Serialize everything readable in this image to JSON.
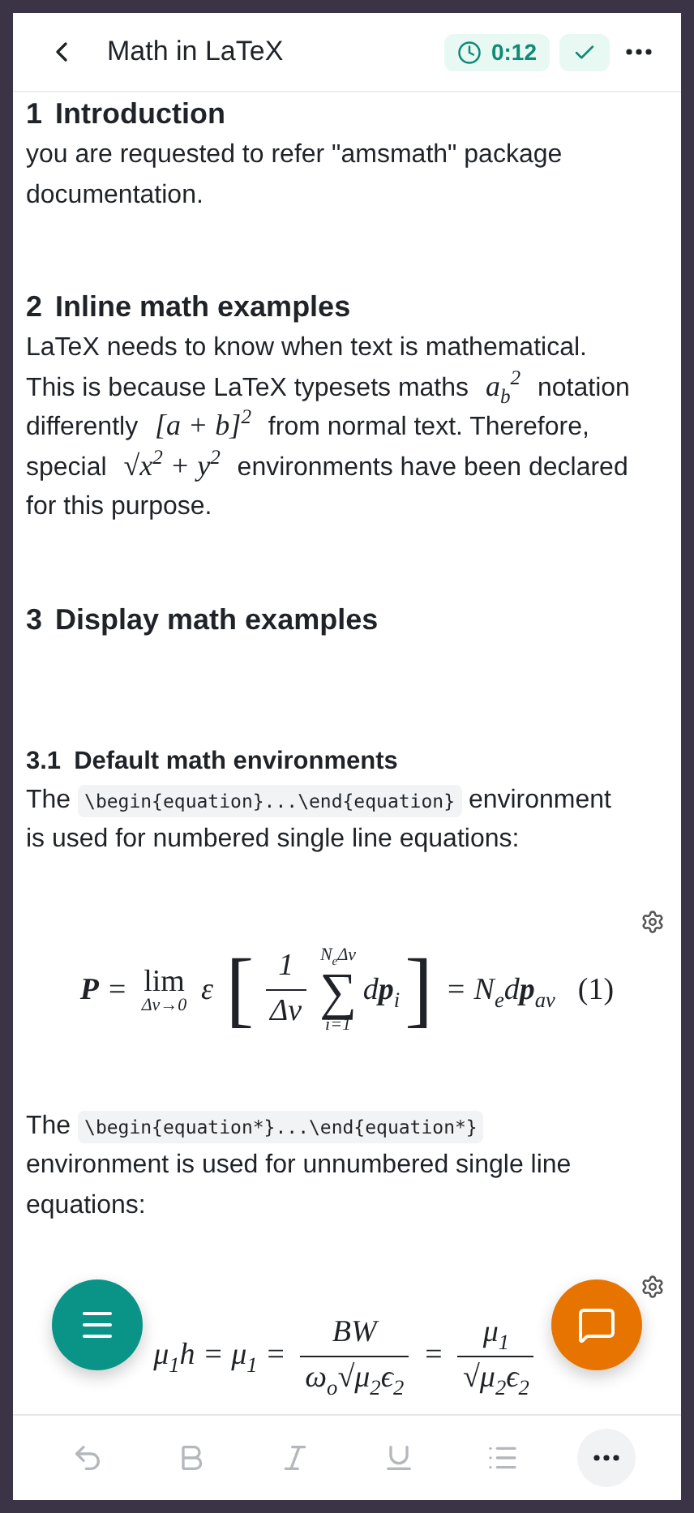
{
  "header": {
    "title": "Math in LaTeX",
    "timer": "0:12",
    "saved": true
  },
  "blocks": [
    {
      "kind": "h1",
      "number": "1",
      "title": "Introduction"
    },
    {
      "kind": "p",
      "segments": [
        {
          "kind": "text",
          "text": "you are requested to refer \"amsmath\" package documentation."
        }
      ]
    },
    {
      "kind": "h1",
      "number": "2",
      "title": "Inline math examples"
    },
    {
      "kind": "p",
      "segments": [
        {
          "kind": "text",
          "text": "LaTeX needs to know when text is mathematical. This is because LaTeX typesets maths "
        },
        {
          "kind": "math",
          "text": "a$_{b}$$^{2}$"
        },
        {
          "kind": "text",
          "text": " notation differently "
        },
        {
          "kind": "math",
          "text": "[a + b]$^{2}$"
        },
        {
          "kind": "text",
          "text": " from normal text. Therefore, special "
        },
        {
          "kind": "math",
          "text": "√x$^{2}$ + y$^{2}$"
        },
        {
          "kind": "text",
          "text": " environments have been declared for this purpose."
        }
      ]
    },
    {
      "kind": "h1",
      "number": "3",
      "title": "Display math examples"
    },
    {
      "kind": "h2",
      "number": "3.1",
      "title": "Default math environments"
    },
    {
      "kind": "p",
      "segments": [
        {
          "kind": "text",
          "text": "The "
        },
        {
          "kind": "code",
          "text": "\\begin{equation}...\\end{equation}"
        },
        {
          "kind": "text",
          "text": " environment is used for numbered single line equations:"
        }
      ]
    },
    {
      "kind": "equation",
      "number": "(1)",
      "settings": true,
      "tokens": [
        {
          "kind": "t",
          "text": "**P** = "
        },
        {
          "kind": "op",
          "symbol": "lim",
          "below": "Δv→0"
        },
        {
          "kind": "t",
          "text": " ε "
        },
        {
          "kind": "big",
          "text": "["
        },
        {
          "kind": "frac",
          "num": "1",
          "den": "Δv"
        },
        {
          "kind": "op",
          "symbol": "∑",
          "above": "N$_{e}$Δv",
          "below": "i=1",
          "large": true
        },
        {
          "kind": "t",
          "text": "d**p**$_{i}$"
        },
        {
          "kind": "big",
          "text": "]"
        },
        {
          "kind": "t",
          "text": " = N$_{e}$d**p**$_{av}$"
        }
      ]
    },
    {
      "kind": "p",
      "segments": [
        {
          "kind": "text",
          "text": "The "
        },
        {
          "kind": "code",
          "text": "\\begin{equation*}...\\end{equation*}"
        },
        {
          "kind": "text",
          "text": " environment is used for unnumbered single line equations:"
        }
      ]
    },
    {
      "kind": "equation",
      "settings": true,
      "tokens": [
        {
          "kind": "t",
          "text": "μ$_{1}$h = μ$_{1}$ = "
        },
        {
          "kind": "frac",
          "num": "BW",
          "den": "ω$_{o}$√μ$_{2}$ϵ$_{2}$"
        },
        {
          "kind": "t",
          "text": " = "
        },
        {
          "kind": "frac",
          "num": "μ$_{1}$",
          "den": "√μ$_{2}$ϵ$_{2}$"
        }
      ]
    }
  ],
  "toolbar": [
    {
      "kind": "undo",
      "disabled": true
    },
    {
      "kind": "bold",
      "disabled": true
    },
    {
      "kind": "italic",
      "disabled": true
    },
    {
      "kind": "underline",
      "disabled": true
    },
    {
      "kind": "list",
      "disabled": true
    },
    {
      "kind": "more",
      "disabled": false
    }
  ]
}
